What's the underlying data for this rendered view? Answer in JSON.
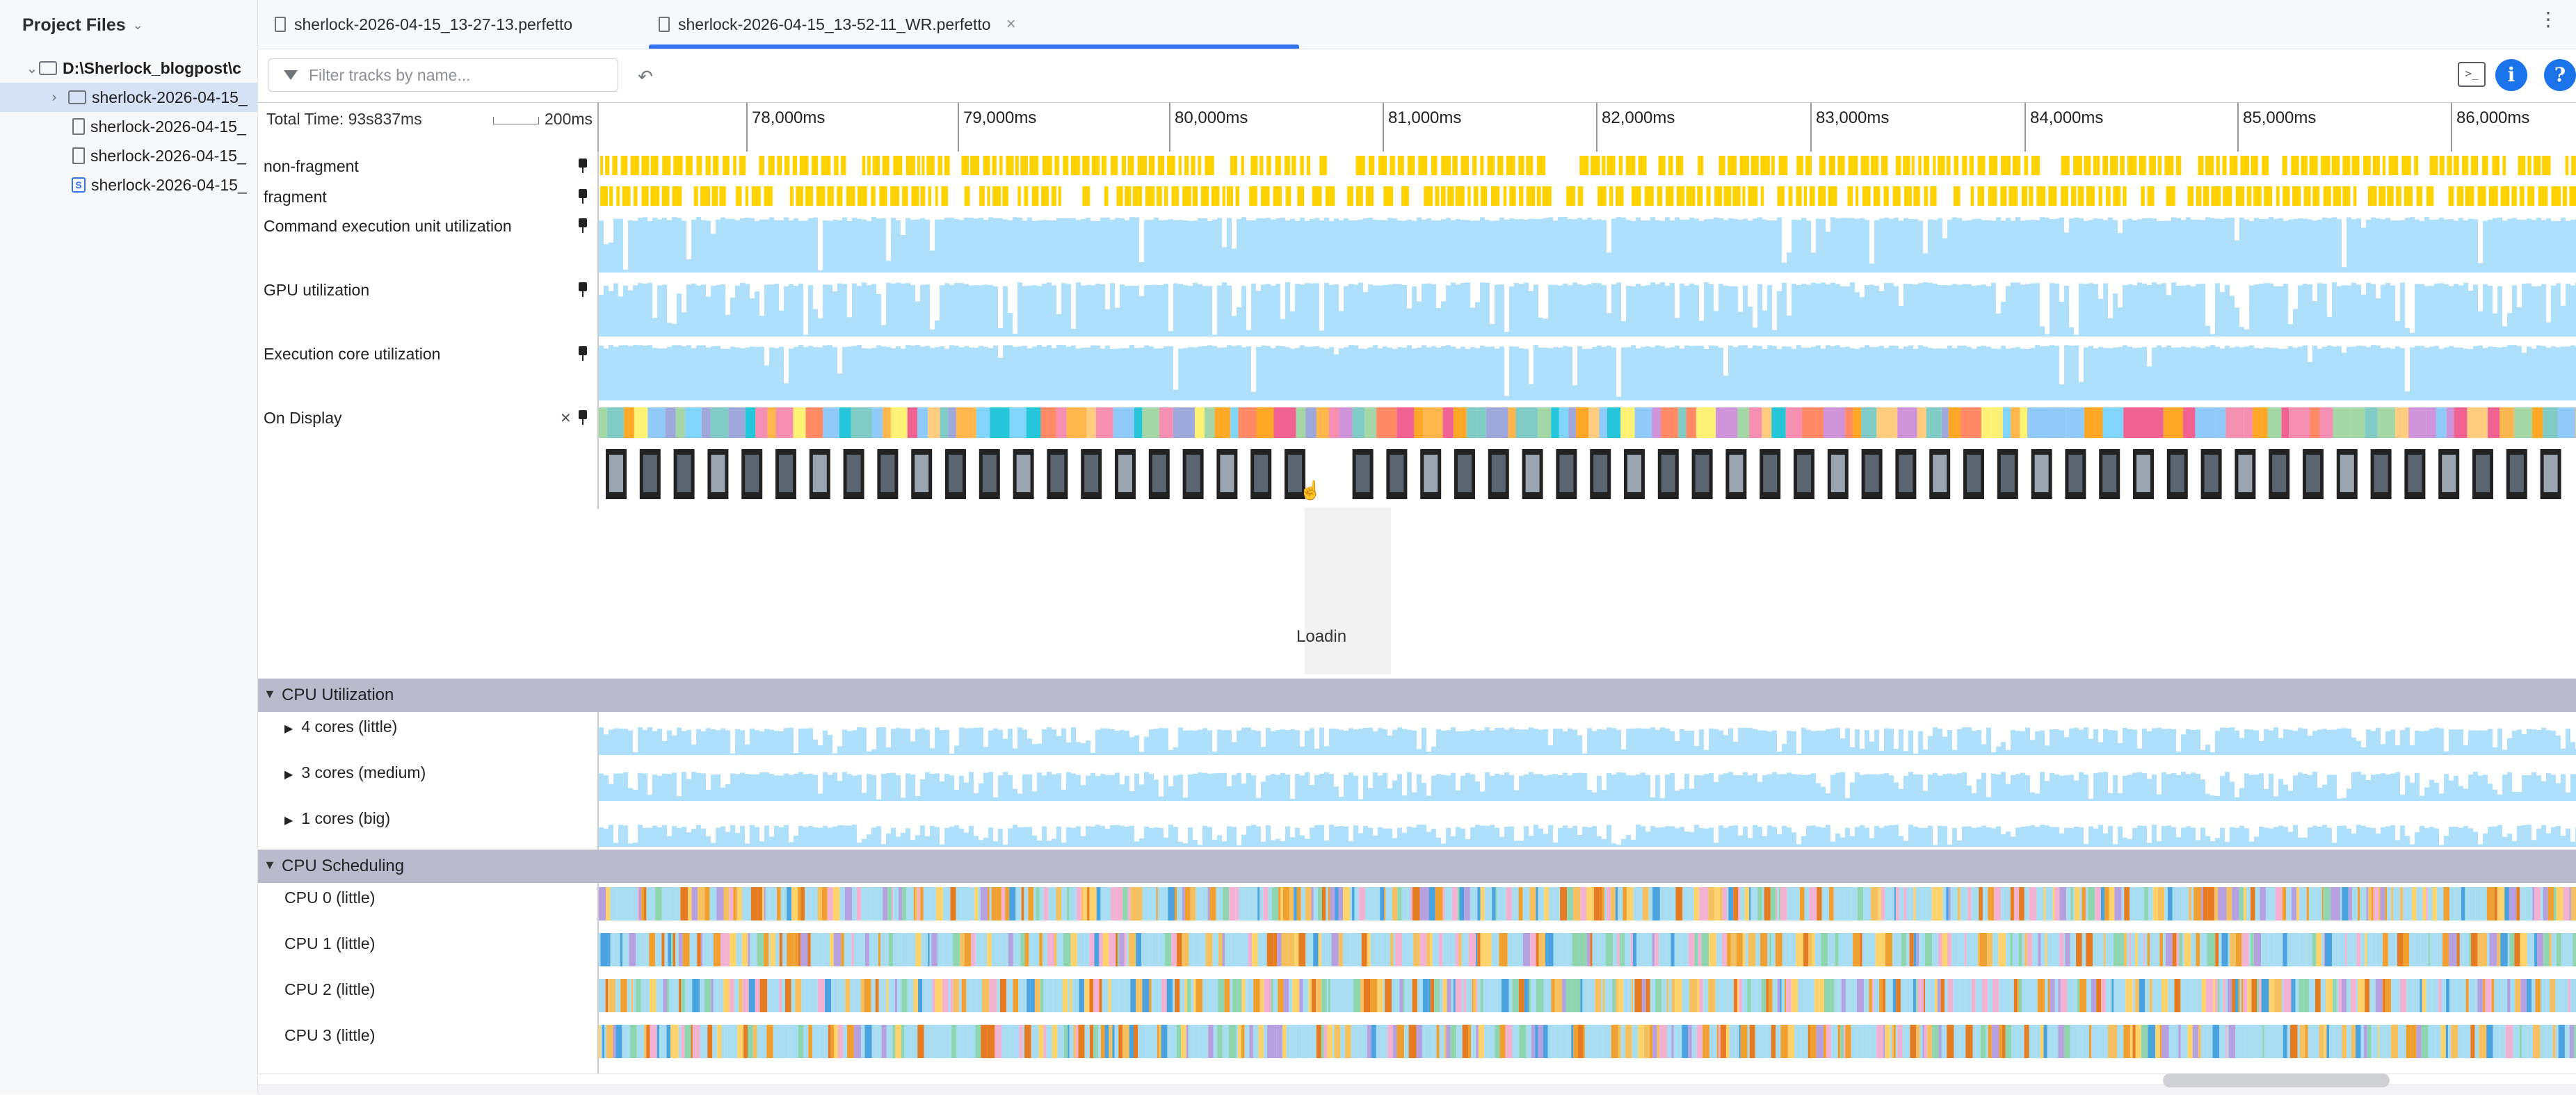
{
  "left_panel": {
    "title": "Project Files",
    "tree": [
      {
        "label": "D:\\Sherlock_blogpost\\c",
        "icon": "folder-icon",
        "expanded": true
      },
      {
        "label": "sherlock-2026-04-15_",
        "icon": "folder-icon",
        "expanded": false,
        "selected": true
      },
      {
        "label": "sherlock-2026-04-15_",
        "icon": "file-icon"
      },
      {
        "label": "sherlock-2026-04-15_",
        "icon": "file-icon"
      },
      {
        "label": "sherlock-2026-04-15_",
        "icon": "trace-file-icon"
      }
    ]
  },
  "tabs": [
    {
      "label": "sherlock-2026-04-15_13-27-13.perfetto",
      "active": false
    },
    {
      "label": "sherlock-2026-04-15_13-52-11_WR.perfetto",
      "active": true,
      "close": "×"
    }
  ],
  "toolbar": {
    "filter_placeholder": "Filter tracks by name...",
    "undo_icon": "undo-icon",
    "console_icon": "console-icon",
    "info_label": "i",
    "help_label": "?"
  },
  "timeline": {
    "total_time": "Total Time: 93s837ms",
    "scale_label": "200ms",
    "ticks": [
      "78,000ms",
      "79,000ms",
      "80,000ms",
      "81,000ms",
      "82,000ms",
      "83,000ms",
      "84,000ms",
      "85,000ms",
      "86,000ms"
    ]
  },
  "tracks": {
    "non_fragment": "non-fragment",
    "fragment": "fragment",
    "command_exec": "Command execution unit utilization",
    "gpu_util": "GPU utilization",
    "exec_core": "Execution core utilization",
    "on_display": "On Display"
  },
  "loading_text": "Loadin",
  "sections": {
    "cpu_utilization": {
      "title": "CPU Utilization",
      "rows": [
        "4 cores (little)",
        "3 cores (medium)",
        "1 cores (big)"
      ]
    },
    "cpu_scheduling": {
      "title": "CPU Scheduling",
      "rows": [
        "CPU 0 (little)",
        "CPU 1 (little)",
        "CPU 2 (little)",
        "CPU 3 (little)"
      ]
    }
  },
  "colors": {
    "accent": "#3574f0",
    "slice_yellow": "#ffd200",
    "util_fill": "#aee0fb",
    "section_header": "#b9bacb"
  }
}
